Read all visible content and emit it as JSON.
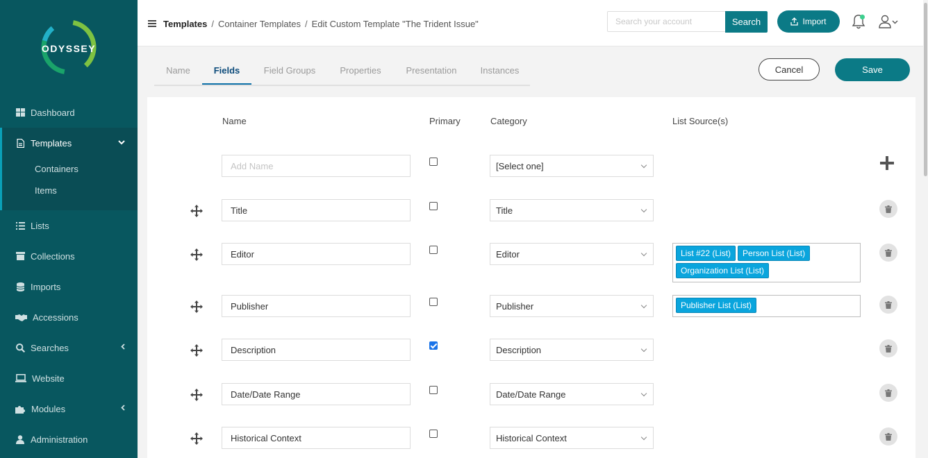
{
  "brand": {
    "name": "ODYSSEY"
  },
  "sidebar": {
    "items": [
      {
        "label": "Dashboard",
        "icon": "dashboard-icon"
      },
      {
        "label": "Templates",
        "icon": "document-icon",
        "expanded": true,
        "children": [
          {
            "label": "Containers"
          },
          {
            "label": "Items"
          }
        ]
      },
      {
        "label": "Lists",
        "icon": "list-icon"
      },
      {
        "label": "Collections",
        "icon": "collections-icon"
      },
      {
        "label": "Imports",
        "icon": "database-icon"
      },
      {
        "label": "Accessions",
        "icon": "handshake-icon"
      },
      {
        "label": "Searches",
        "icon": "search-icon"
      },
      {
        "label": "Website",
        "icon": "laptop-icon"
      },
      {
        "label": "Modules",
        "icon": "puzzle-icon"
      },
      {
        "label": "Administration",
        "icon": "user-icon"
      }
    ]
  },
  "header": {
    "breadcrumb": [
      "Templates",
      "Container Templates",
      "Edit Custom Template \"The Trident Issue\""
    ],
    "separator": "/",
    "search": {
      "placeholder": "Search your account",
      "value": "",
      "button_label": "Search"
    },
    "import_label": "Import",
    "accent_color": "#0b7a86",
    "notification_dot_color": "#3ccf8e"
  },
  "tabs": [
    {
      "label": "Name",
      "active": false
    },
    {
      "label": "Fields",
      "active": true
    },
    {
      "label": "Field Groups",
      "active": false
    },
    {
      "label": "Properties",
      "active": false
    },
    {
      "label": "Presentation",
      "active": false
    },
    {
      "label": "Instances",
      "active": false
    }
  ],
  "actions": {
    "cancel_label": "Cancel",
    "save_label": "Save"
  },
  "table": {
    "headers": {
      "name": "Name",
      "primary": "Primary",
      "category": "Category",
      "sources": "List Source(s)"
    },
    "new_row": {
      "placeholder": "Add Name",
      "value": "",
      "primary": false,
      "category": "[Select one]"
    },
    "rows": [
      {
        "name": "Title",
        "primary": false,
        "category": "Title",
        "sources": []
      },
      {
        "name": "Editor",
        "primary": false,
        "category": "Editor",
        "sources": [
          "List #22 (List)",
          "Person List (List)",
          "Organization List (List)"
        ]
      },
      {
        "name": "Publisher",
        "primary": false,
        "category": "Publisher",
        "sources": [
          "Publisher List (List)"
        ]
      },
      {
        "name": "Description",
        "primary": true,
        "category": "Description",
        "sources": []
      },
      {
        "name": "Date/Date Range",
        "primary": false,
        "category": "Date/Date Range",
        "sources": []
      },
      {
        "name": "Historical Context",
        "primary": false,
        "category": "Historical Context",
        "sources": []
      }
    ]
  }
}
